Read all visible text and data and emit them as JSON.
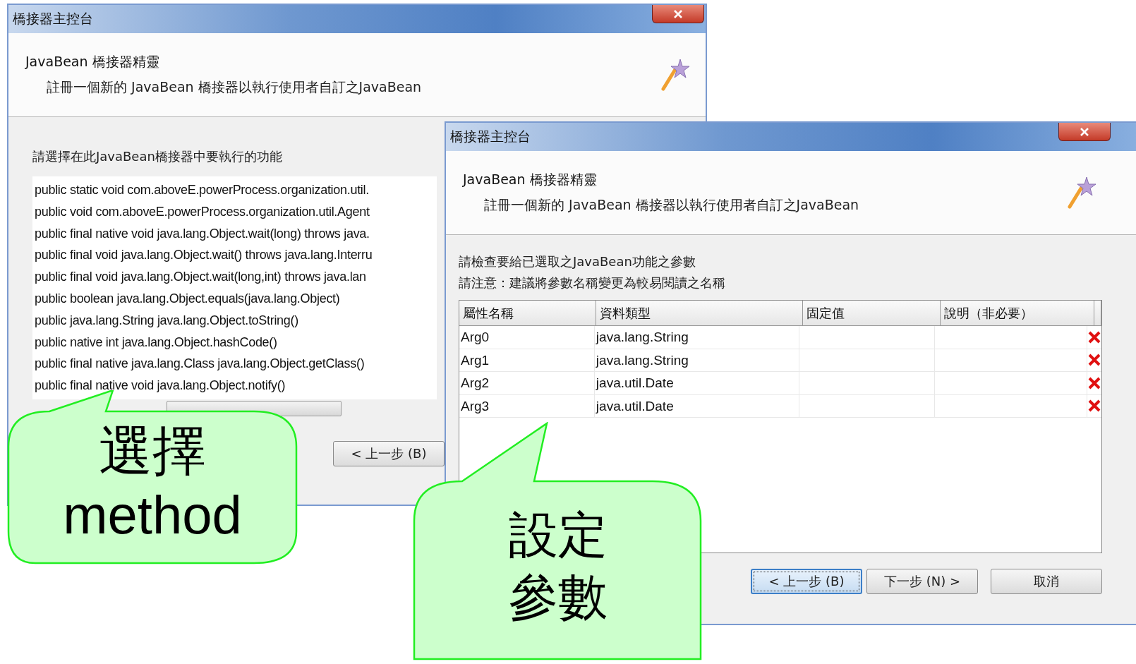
{
  "windows": [
    {
      "kind": "method-list",
      "title": "橋接器主控台",
      "wizard_title": "JavaBean 橋接器精靈",
      "wizard_subtitle": "註冊一個新的 JavaBean 橋接器以執行使用者自訂之JavaBean",
      "prompts": [
        "請選擇在此JavaBean橋接器中要執行的功能"
      ],
      "methods": [
        "public static void com.aboveE.powerProcess.organization.util.",
        "public void com.aboveE.powerProcess.organization.util.Agent",
        "public final native void java.lang.Object.wait(long) throws java.",
        "public final void java.lang.Object.wait() throws java.lang.Interru",
        "public final void java.lang.Object.wait(long,int) throws java.lan",
        "public boolean java.lang.Object.equals(java.lang.Object)",
        "public java.lang.String java.lang.Object.toString()",
        "public native int java.lang.Object.hashCode()",
        "public final native java.lang.Class java.lang.Object.getClass()",
        "public final native void java.lang.Object.notify()"
      ],
      "buttons": [
        {
          "label": "< 上一步 (B)",
          "focused": false
        }
      ]
    },
    {
      "kind": "parameter-table",
      "title": "橋接器主控台",
      "wizard_title": "JavaBean 橋接器精靈",
      "wizard_subtitle": "註冊一個新的 JavaBean 橋接器以執行使用者自訂之JavaBean",
      "prompts": [
        "請檢查要給已選取之JavaBean功能之參數",
        "請注意：建議將參數名稱變更為較易閱讀之名稱"
      ],
      "table": {
        "columns": [
          "屬性名稱",
          "資料類型",
          "固定值",
          "說明（非必要）"
        ],
        "rows": [
          {
            "cells": [
              "Arg0",
              "java.lang.String",
              "",
              ""
            ]
          },
          {
            "cells": [
              "Arg1",
              "java.lang.String",
              "",
              ""
            ]
          },
          {
            "cells": [
              "Arg2",
              "java.util.Date",
              "",
              ""
            ]
          },
          {
            "cells": [
              "Arg3",
              "java.util.Date",
              "",
              ""
            ]
          }
        ]
      },
      "buttons": [
        {
          "label": "< 上一步 (B)",
          "focused": true
        },
        {
          "label": "下一步 (N) >",
          "focused": false
        },
        {
          "label": "取消",
          "focused": false
        }
      ]
    }
  ],
  "callouts": [
    {
      "lines": [
        "選擇",
        "method"
      ]
    },
    {
      "lines": [
        "設定",
        "參數"
      ]
    }
  ]
}
